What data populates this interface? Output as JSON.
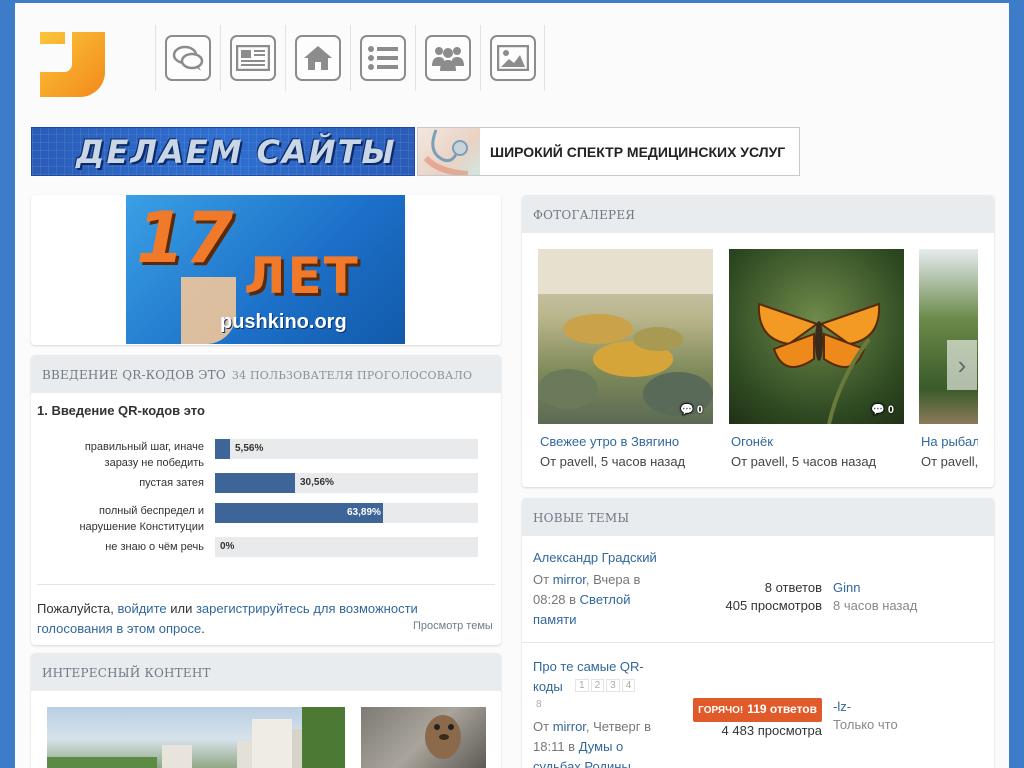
{
  "brand": {
    "logo_color": "#f7a51c"
  },
  "nav": [
    {
      "icon": "chat-icon"
    },
    {
      "icon": "news-icon"
    },
    {
      "icon": "home-icon"
    },
    {
      "icon": "list-icon"
    },
    {
      "icon": "users-icon"
    },
    {
      "icon": "image-icon"
    }
  ],
  "banners": {
    "web": "ДЕЛАЕМ САЙТЫ",
    "medical": "ШИРОКИЙ СПЕКТР МЕДИЦИНСКИХ УСЛУГ"
  },
  "anniversary": {
    "number": "17",
    "word": "ЛЕТ",
    "site": "pushkino.org"
  },
  "poll": {
    "header": "Введение QR-кодов это",
    "header_sub": "34 пользователя проголосовало",
    "question": "1. Введение QR-кодов это",
    "options": [
      {
        "label": "правильный шаг, иначе заразу не победить",
        "percent": 5.56,
        "display": "5,56%"
      },
      {
        "label": "пустая затея",
        "percent": 30.56,
        "display": "30,56%"
      },
      {
        "label": "полный беспредел и нарушение Конституции",
        "percent": 63.89,
        "display": "63,89%"
      },
      {
        "label": "не знаю о чём речь",
        "percent": 0,
        "display": "0%"
      }
    ],
    "login_prefix": "Пожалуйста, ",
    "login_link": "войдите",
    "login_or": " или ",
    "register_link": "зарегистрируйтесь для возможности голосования в этом опросе",
    "login_suffix": ".",
    "view_topic": "Просмотр темы"
  },
  "interesting": {
    "header": "Интересный контент"
  },
  "gallery": {
    "header": "Фотогалерея",
    "items": [
      {
        "title": "Свежее утро в Звягино",
        "meta": "От pavell, 5 часов назад",
        "comments": "0"
      },
      {
        "title": "Огонёк",
        "meta": "От pavell, 5 часов назад",
        "comments": "0"
      },
      {
        "title": "На рыбал",
        "meta": "От pavell,",
        "comments": ""
      }
    ]
  },
  "topics": {
    "header": "Новые темы",
    "items": [
      {
        "title": "Александр Градский",
        "from": "От ",
        "author": "mirror",
        "when": ", Вчера в 08:28 в ",
        "forum": "Светлой памяти",
        "replies": "8 ответов",
        "views": "405 просмотров",
        "last_user": "Ginn",
        "last_time": "8 часов назад"
      },
      {
        "title": "Про те самые QR-коды",
        "pages": [
          "1",
          "2",
          "3",
          "4",
          "8"
        ],
        "from": "От ",
        "author": "mirror",
        "when": ", Четверг в 18:11 в ",
        "forum": "Думы о судьбах Родины",
        "hot": "ГОРЯЧО!",
        "replies": "119 ответов",
        "views": "4 483 просмотра",
        "last_user": "-lz-",
        "last_time": "Только что"
      }
    ]
  }
}
